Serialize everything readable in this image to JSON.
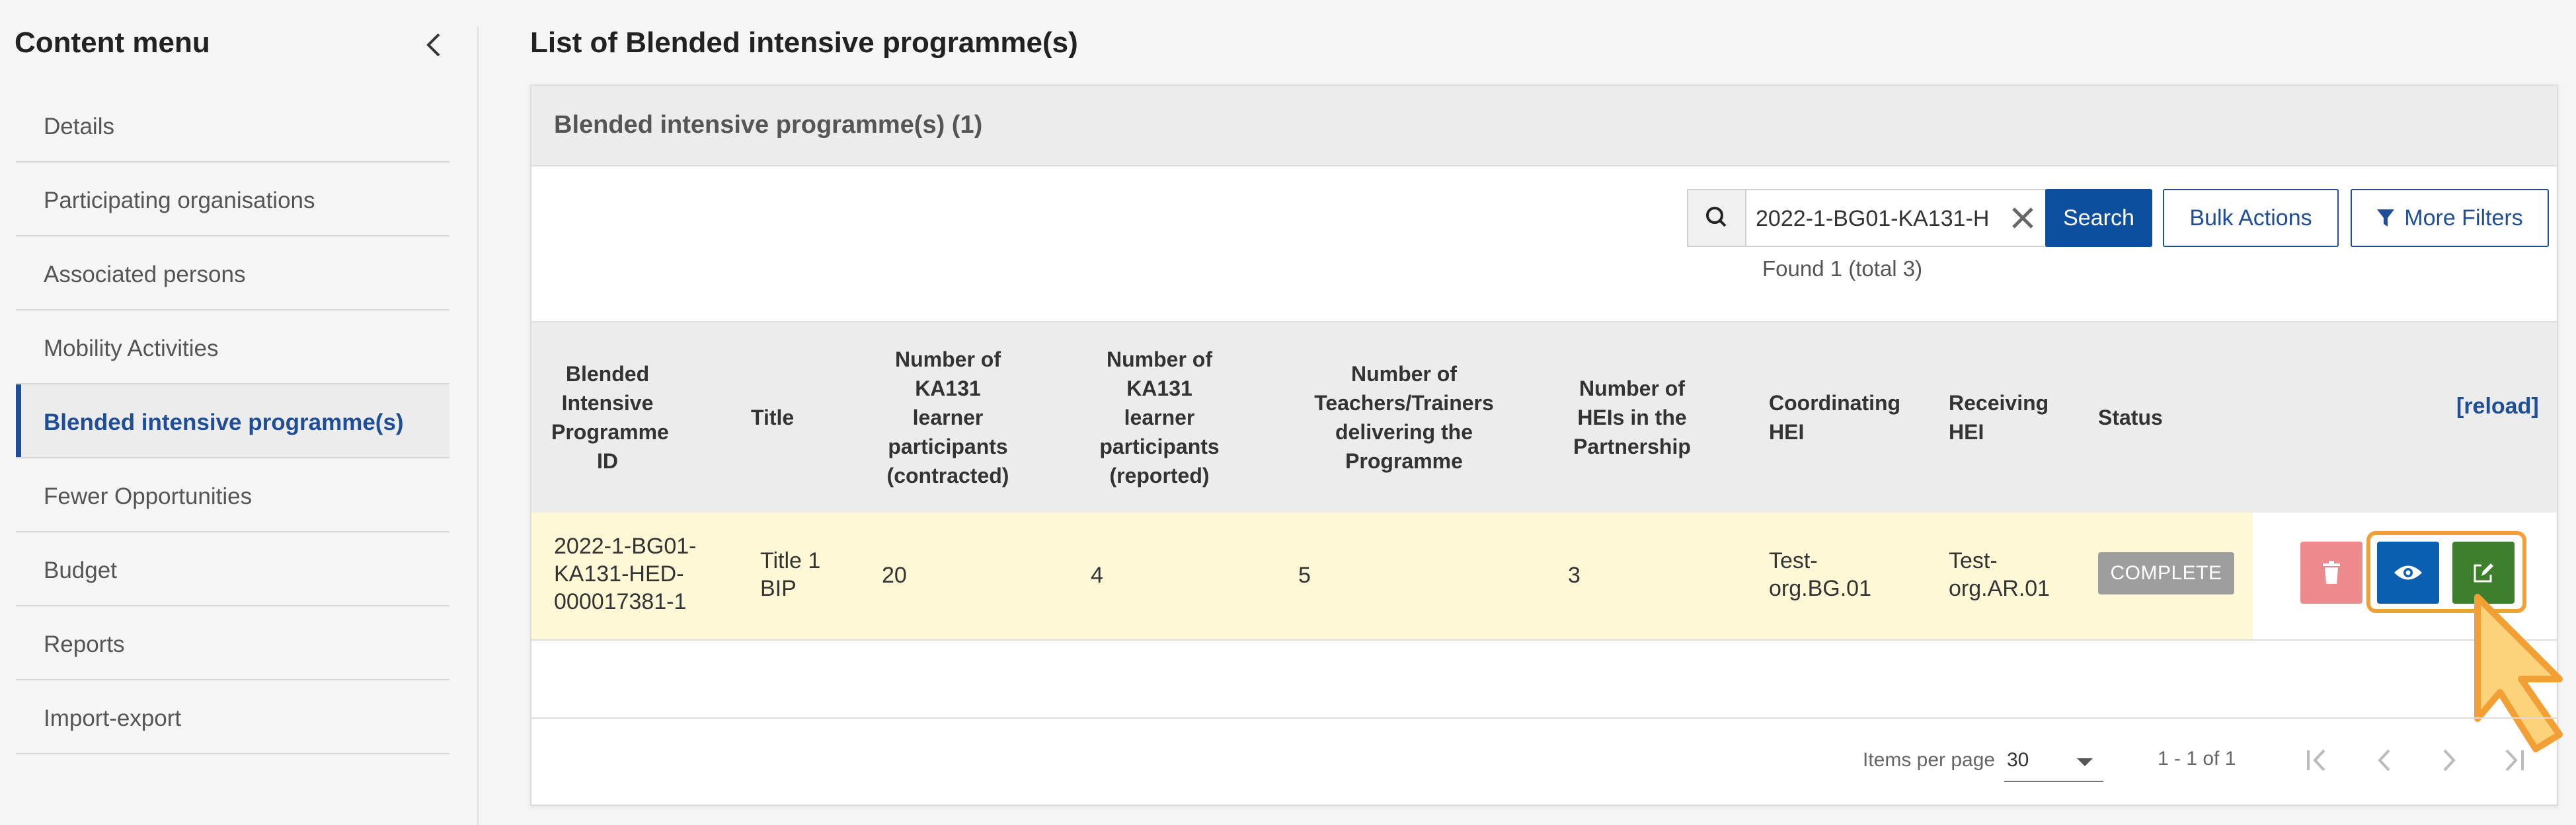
{
  "sidebar": {
    "title": "Content menu",
    "items": [
      {
        "label": "Details",
        "active": false
      },
      {
        "label": "Participating organisations",
        "active": false
      },
      {
        "label": "Associated persons",
        "active": false
      },
      {
        "label": "Mobility Activities",
        "active": false
      },
      {
        "label": "Blended intensive programme(s)",
        "active": true
      },
      {
        "label": "Fewer Opportunities",
        "active": false
      },
      {
        "label": "Budget",
        "active": false
      },
      {
        "label": "Reports",
        "active": false
      },
      {
        "label": "Import-export",
        "active": false
      }
    ]
  },
  "main": {
    "page_title": "List of Blended intensive programme(s)",
    "card_title": "Blended intensive programme(s) (1)",
    "search": {
      "value": "2022-1-BG01-KA131-H",
      "button_label": "Search"
    },
    "bulk_actions_label": "Bulk Actions",
    "more_filters_label": "More Filters",
    "found_text": "Found 1 (total 3)",
    "reload_label": "[reload]",
    "columns": [
      {
        "lines": [
          "Blended",
          "Intensive",
          "Programme",
          "ID"
        ]
      },
      {
        "lines": [
          "Title"
        ]
      },
      {
        "lines": [
          "Number of",
          "KA131",
          "learner",
          "participants",
          "(contracted)"
        ]
      },
      {
        "lines": [
          "Number of",
          "KA131",
          "learner",
          "participants",
          "(reported)"
        ]
      },
      {
        "lines": [
          "Number of",
          "Teachers/Trainers",
          "delivering the",
          "Programme"
        ]
      },
      {
        "lines": [
          "Number of",
          "HEIs in the",
          "Partnership"
        ]
      },
      {
        "lines": [
          "Coordinating",
          "HEI"
        ]
      },
      {
        "lines": [
          "Receiving",
          "HEI"
        ]
      },
      {
        "lines": [
          "Status"
        ]
      }
    ],
    "rows": [
      {
        "id": [
          "2022-1-BG01-",
          "KA131-HED-",
          "000017381-1"
        ],
        "title": [
          "Title 1",
          "BIP"
        ],
        "contracted": "20",
        "reported": "4",
        "teachers": "5",
        "heis": "3",
        "coordinating": [
          "Test-",
          "org.BG.01"
        ],
        "receiving": [
          "Test-",
          "org.AR.01"
        ],
        "status": "COMPLETE"
      }
    ],
    "pagination": {
      "items_per_page_label": "Items per page",
      "items_per_page": "30",
      "range": "1 - 1 of 1"
    }
  },
  "colors": {
    "primary": "#0b4f9e",
    "delete": "#ec8a8e",
    "view": "#0b5fb0",
    "edit": "#3e7f2e",
    "row_highlight": "#fff8d6",
    "status_complete": "#9e9e9e",
    "callout": "#f2a035"
  },
  "icons": {
    "collapse": "chevron-left-icon",
    "search": "search-icon",
    "clear": "close-icon",
    "filter": "filter-icon",
    "delete": "trash-icon",
    "view": "eye-icon",
    "edit": "edit-icon",
    "pointer": "hand-pointer-icon",
    "first": "first-page-icon",
    "prev": "chevron-left-icon",
    "next": "chevron-right-icon",
    "last": "last-page-icon"
  }
}
